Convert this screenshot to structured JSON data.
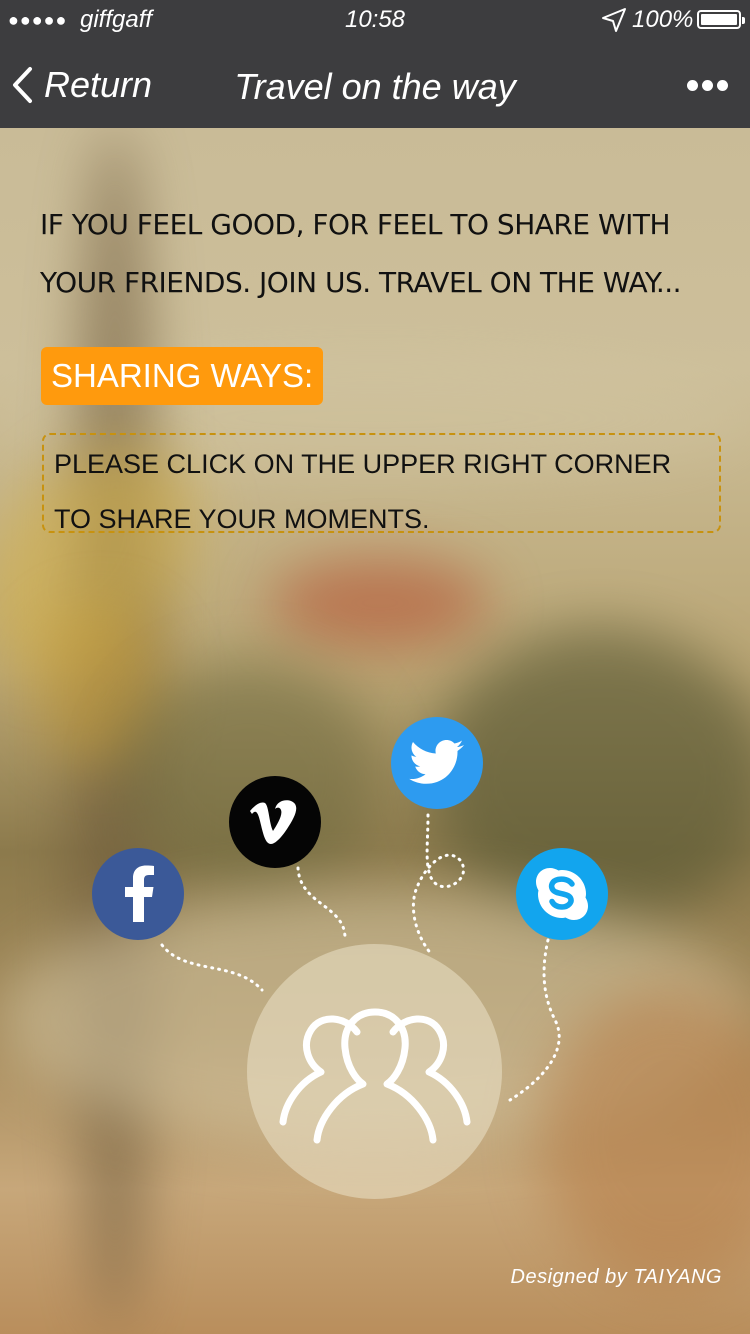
{
  "status_bar": {
    "signal": "●●●●●",
    "carrier": "giffgaff",
    "time": "10:58",
    "battery_percent": "100%",
    "battery_level": 1.0
  },
  "nav": {
    "back_label": "Return",
    "title": "Travel on the way"
  },
  "content": {
    "intro_line1": "IF YOU FEEL GOOD, FOR FEEL TO SHARE WITH",
    "intro_line2": "YOUR FRIENDS. JOIN US. TRAVEL ON THE WAY...",
    "badge": "SHARING WAYS:",
    "note_line1": "PLEASE CLICK ON THE UPPER RIGHT CORNER",
    "note_line2": "TO SHARE YOUR MOMENTS."
  },
  "social": [
    {
      "name": "facebook-icon",
      "color": "#3b5998"
    },
    {
      "name": "vimeo-icon",
      "color": "#050505"
    },
    {
      "name": "twitter-icon",
      "color": "#2d9bf0"
    },
    {
      "name": "skype-icon",
      "color": "#12a5ee"
    }
  ],
  "hub_icon": "group-icon",
  "footer": {
    "credit": "Designed by TAIYANG"
  },
  "colors": {
    "nav_bg": "#3d3d3f",
    "accent": "#ff9a0d",
    "note_border": "#c8920f"
  }
}
